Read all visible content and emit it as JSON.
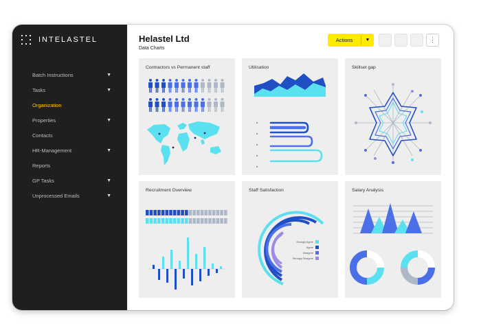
{
  "app": {
    "brand": "INTELASTEL"
  },
  "sidebar": {
    "items": [
      {
        "label": "Batch Instructions",
        "caret": true,
        "active": false
      },
      {
        "label": "Tasks",
        "caret": true,
        "active": false
      },
      {
        "label": "Organization",
        "caret": false,
        "active": true
      },
      {
        "label": "Properties",
        "caret": true,
        "active": false
      },
      {
        "label": "Contacts",
        "caret": false,
        "active": false
      },
      {
        "label": "HR-Management",
        "caret": true,
        "active": false
      },
      {
        "label": "Reports",
        "caret": false,
        "active": false
      },
      {
        "label": "GP Tasks",
        "caret": true,
        "active": false
      },
      {
        "label": "Unprocessed Emails",
        "caret": true,
        "active": false
      }
    ]
  },
  "header": {
    "title": "Helastel Ltd",
    "subtitle": "Data Charts",
    "actions_label": "Actions",
    "more_icon": "⋮"
  },
  "panels": {
    "contractors": {
      "title": "Contractors vs Permanent staff",
      "row1": {
        "dark": 3,
        "blue": 5,
        "light": 4
      },
      "row2": {
        "dark": 3,
        "blue": 6,
        "light": 3
      }
    },
    "utilisation": {
      "title": "Utilisation"
    },
    "skillset": {
      "title": "Skillset gap"
    },
    "recruitment": {
      "title": "Recruitment Overview"
    },
    "satisfaction": {
      "title": "Staff Satisfaction",
      "legend": [
        "Strongly Agree",
        "Agree",
        "Disagree",
        "Strongly Disagree"
      ]
    },
    "salary": {
      "title": "Salary Analysis"
    }
  },
  "colors": {
    "dark_blue": "#1f4fc3",
    "blue": "#4a6fe6",
    "light_blue": "#5ae0ee",
    "lavender": "#9b8be6",
    "grey_icon": "#aeb8c7",
    "yellow": "#ffeb00"
  }
}
